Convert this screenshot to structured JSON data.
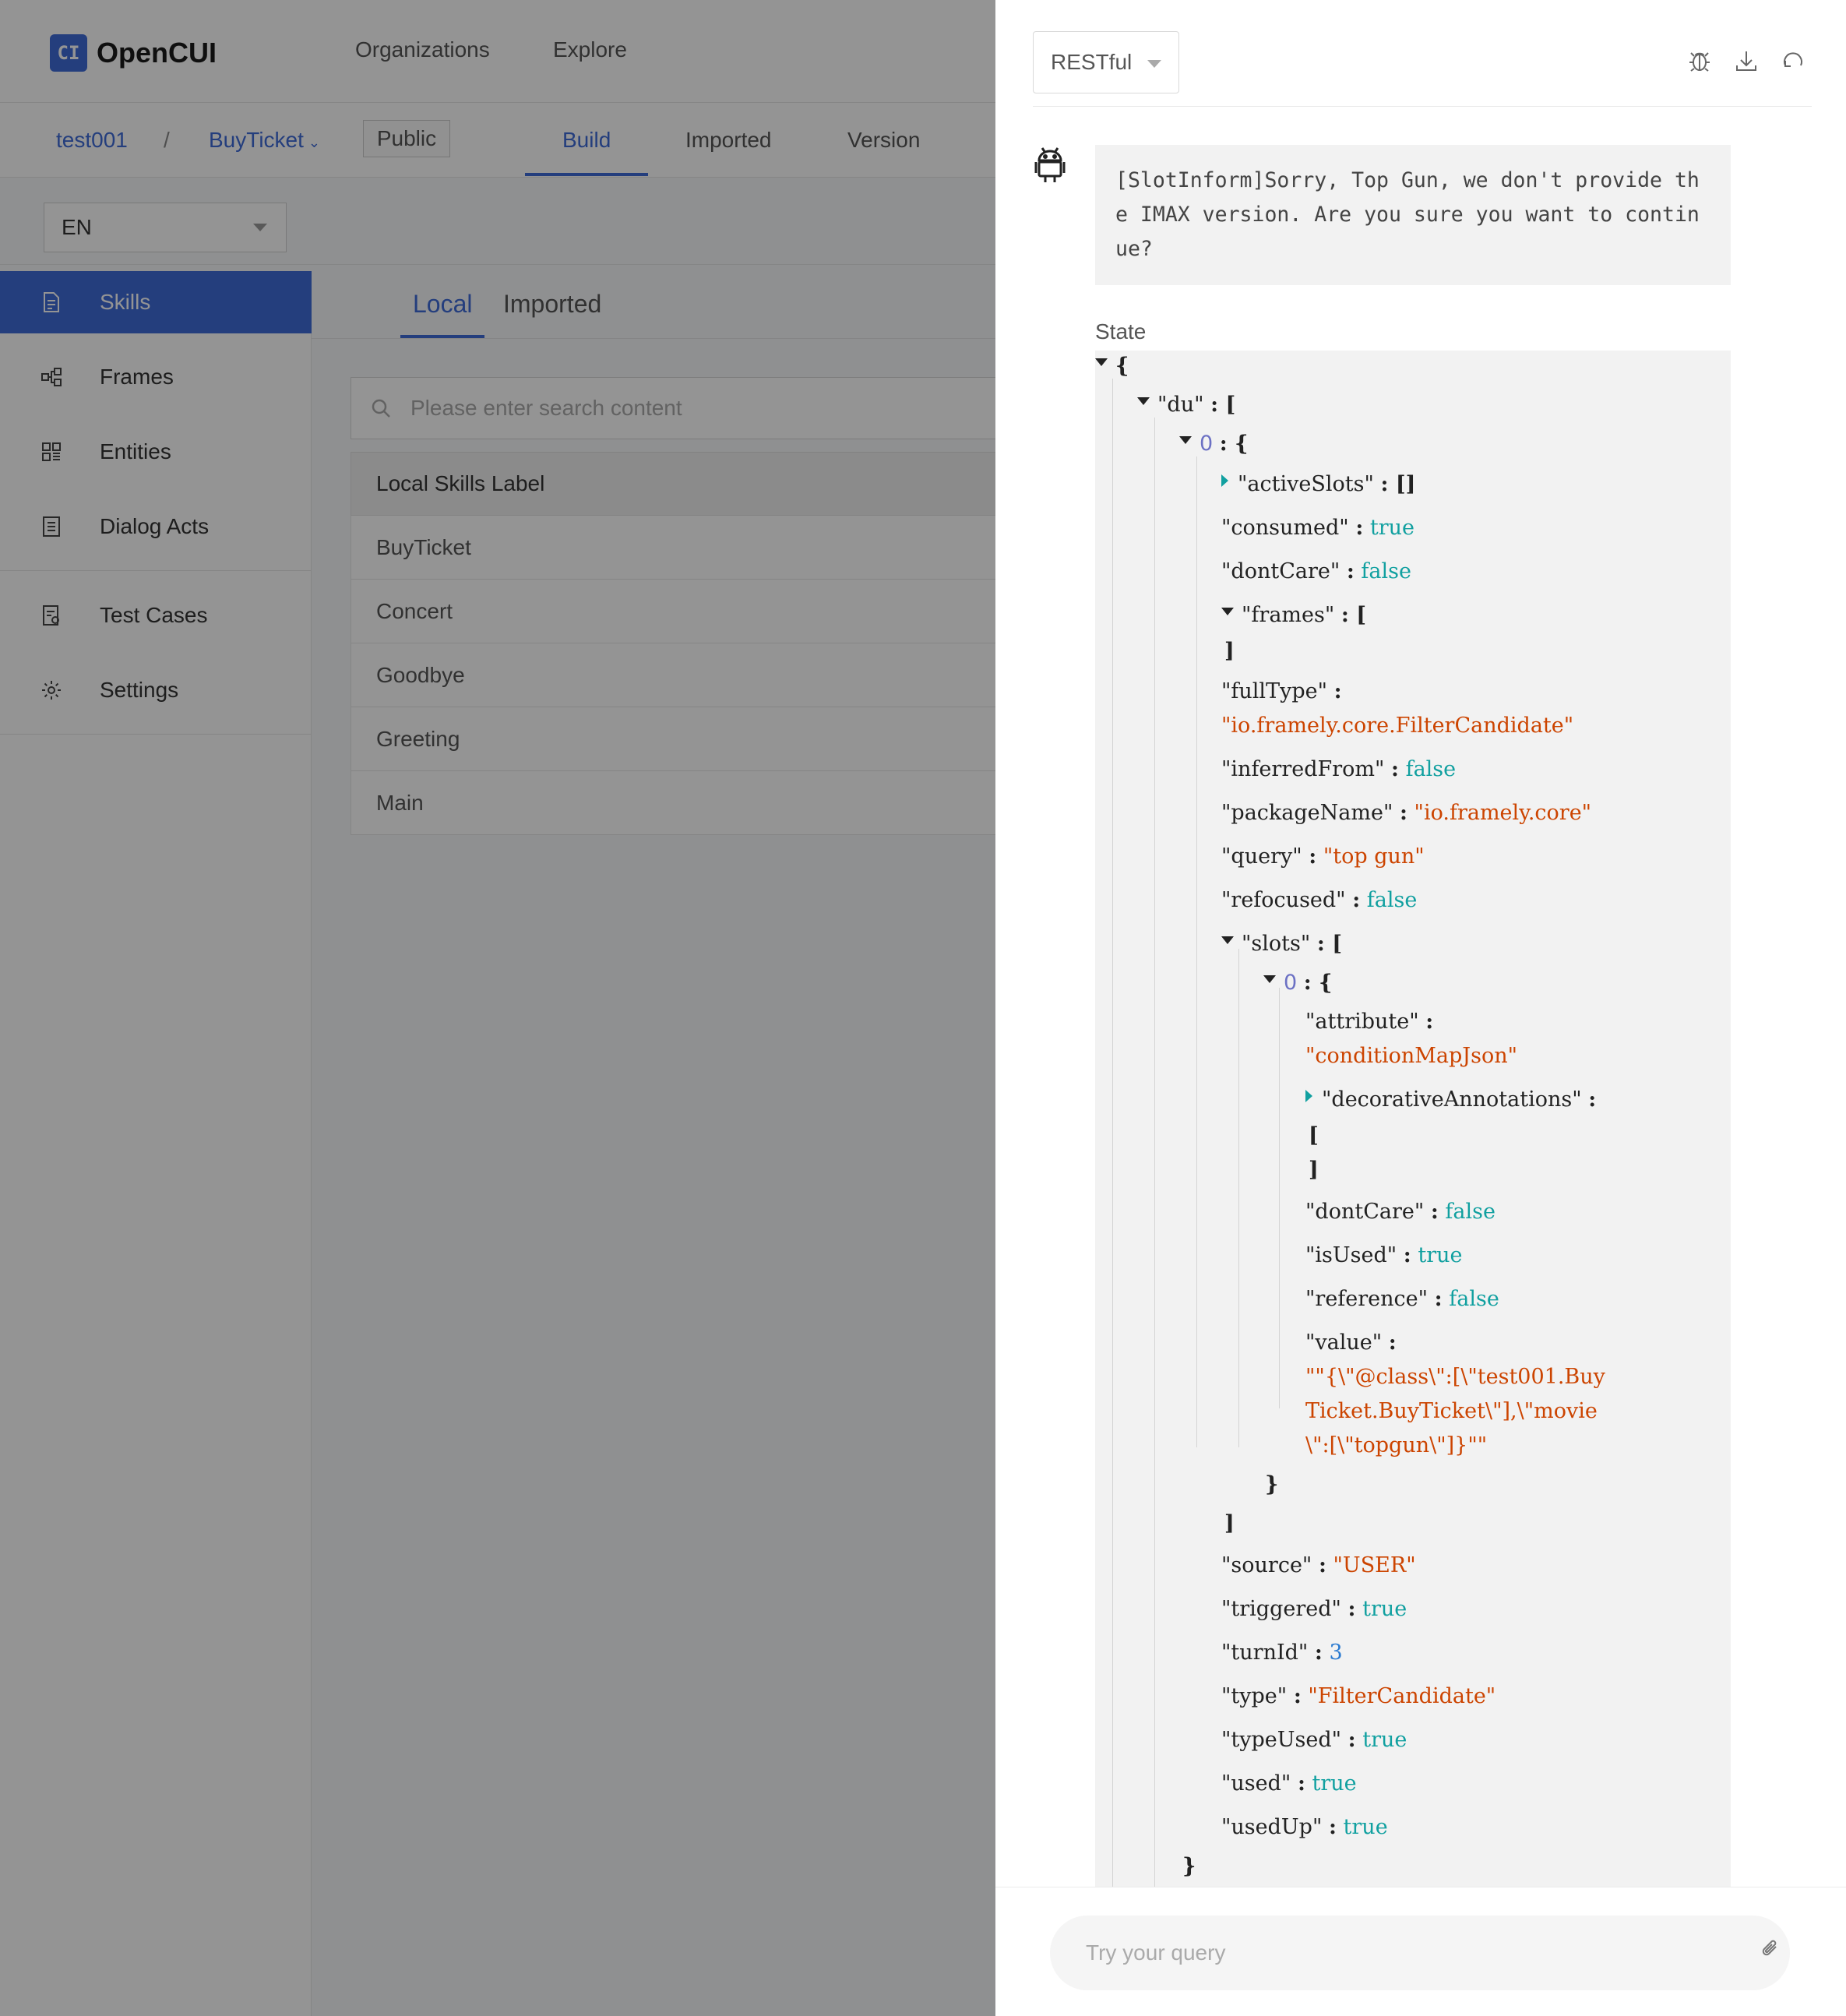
{
  "app": {
    "brand": "OpenCUI",
    "logo_glyph": "CI",
    "nav": [
      "Organizations",
      "Explore"
    ]
  },
  "breadcrumb": {
    "org": "test001",
    "separator": "/",
    "project": "BuyTicket",
    "visibility": "Public"
  },
  "project_tabs": [
    "Build",
    "Imported",
    "Version"
  ],
  "language": "EN",
  "sidebar": {
    "items": [
      {
        "label": "Skills",
        "icon": "file-icon",
        "active": true
      },
      {
        "label": "Frames",
        "icon": "frames-icon"
      },
      {
        "label": "Entities",
        "icon": "entities-icon"
      },
      {
        "label": "Dialog Acts",
        "icon": "dialog-acts-icon"
      },
      {
        "label": "Test Cases",
        "icon": "test-cases-icon"
      },
      {
        "label": "Settings",
        "icon": "gear-icon"
      }
    ]
  },
  "content": {
    "tabs": [
      "Local",
      "Imported"
    ],
    "search_placeholder": "Please enter search content",
    "table_header": "Local Skills Label",
    "rows": [
      "BuyTicket",
      "Concert",
      "Goodbye",
      "Greeting",
      "Main"
    ]
  },
  "debug": {
    "mode": "RESTful",
    "tools": [
      "bug-icon",
      "download-icon",
      "refresh-icon"
    ],
    "bot_message": "[SlotInform]Sorry, Top Gun, we don't provide the IMAX version. Are you sure you want to continue?",
    "state_label": "State",
    "state": {
      "du_key": "\"du\"",
      "index0": "0",
      "activeSlots_key": "\"activeSlots\"",
      "activeSlots_val": "[]",
      "consumed_key": "\"consumed\"",
      "consumed_val": "true",
      "dontCare_key": "\"dontCare\"",
      "dontCare_val": "false",
      "frames_key": "\"frames\"",
      "fullType_key": "\"fullType\"",
      "fullType_val": "\"io.framely.core.FilterCandidate\"",
      "inferredFrom_key": "\"inferredFrom\"",
      "inferredFrom_val": "false",
      "packageName_key": "\"packageName\"",
      "packageName_val": "\"io.framely.core\"",
      "query_key": "\"query\"",
      "query_val": "\"top gun\"",
      "refocused_key": "\"refocused\"",
      "refocused_val": "false",
      "slots_key": "\"slots\"",
      "slot_index0": "0",
      "attribute_key": "\"attribute\"",
      "attribute_val": "\"conditionMapJson\"",
      "decorativeAnnotations_key": "\"decorativeAnnotations\"",
      "slot_dontCare_key": "\"dontCare\"",
      "slot_dontCare_val": "false",
      "isUsed_key": "\"isUsed\"",
      "isUsed_val": "true",
      "reference_key": "\"reference\"",
      "reference_val": "false",
      "value_key": "\"value\"",
      "value_line1": "\"\"{\\\"@class\\\":[\\\"test001.Buy",
      "value_line2": "Ticket.BuyTicket\\\"],\\\"movie",
      "value_line3": "\\\":[\\\"topgun\\\"]}\"\"",
      "source_key": "\"source\"",
      "source_val": "\"USER\"",
      "triggered_key": "\"triggered\"",
      "triggered_val": "true",
      "turnId_key": "\"turnId\"",
      "turnId_val": "3",
      "type_key": "\"type\"",
      "type_val": "\"FilterCandidate\"",
      "typeUsed_key": "\"typeUsed\"",
      "typeUsed_val": "true",
      "used_key": "\"used\"",
      "used_val": "true",
      "usedUp_key": "\"usedUp\"",
      "usedUp_val": "true"
    },
    "query_placeholder": "Try your query"
  },
  "colors": {
    "accent": "#3f6bd8",
    "json_bool": "#11a0a0",
    "json_string": "#cc4400",
    "json_number": "#2a7ad0",
    "overlay": "rgba(0,0,0,0.42)"
  }
}
